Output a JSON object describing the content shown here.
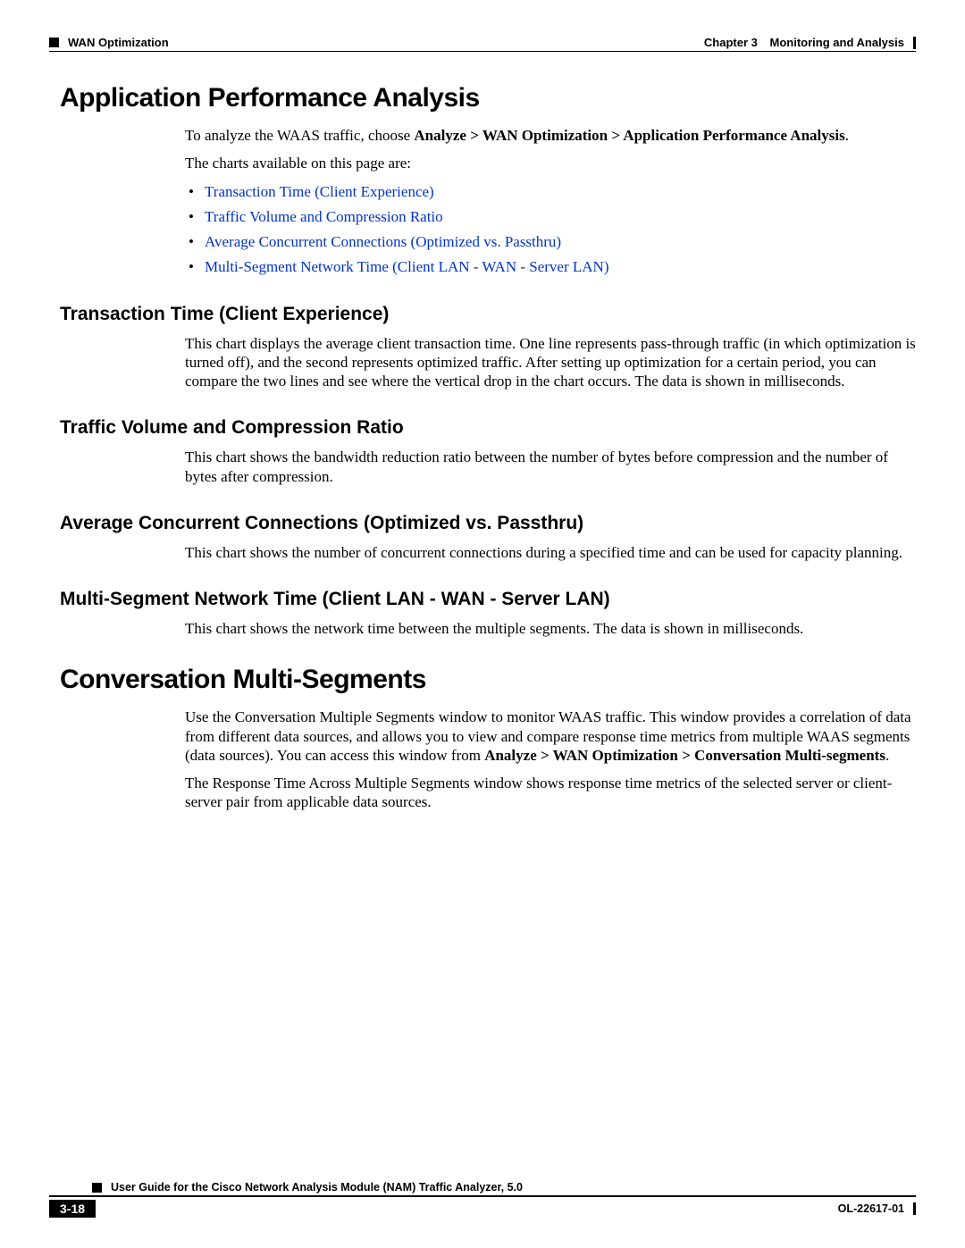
{
  "header": {
    "left_label": "WAN Optimization",
    "chapter_label": "Chapter 3",
    "chapter_title": "Monitoring and Analysis"
  },
  "section1": {
    "title": "Application Performance Analysis",
    "intro_a": "To analyze the WAAS traffic, choose ",
    "intro_b": "Analyze > WAN Optimization > Application Performance Analysis",
    "intro_c": ".",
    "charts_intro": "The charts available on this page are:",
    "bullets": {
      "b1": "Transaction Time (Client Experience)",
      "b2": "Traffic Volume and Compression Ratio",
      "b3": "Average Concurrent Connections (Optimized vs. Passthru)",
      "b4": "Multi-Segment Network Time (Client LAN - WAN - Server LAN)"
    }
  },
  "sub1": {
    "title": "Transaction Time (Client Experience)",
    "body": "This chart displays the average client transaction time. One line represents pass-through traffic (in which optimization is turned off), and the second represents optimized traffic. After setting up optimization for a certain period, you can compare the two lines and see where the vertical drop in the chart occurs. The data is shown in milliseconds."
  },
  "sub2": {
    "title": "Traffic Volume and Compression Ratio",
    "body": "This chart shows the bandwidth reduction ratio between the number of bytes before compression and the number of bytes after compression."
  },
  "sub3": {
    "title": "Average Concurrent Connections (Optimized vs. Passthru)",
    "body": "This chart shows the number of concurrent connections during a specified time and can be used for capacity planning."
  },
  "sub4": {
    "title": "Multi-Segment Network Time (Client LAN - WAN - Server LAN)",
    "body": "This chart shows the network time between the multiple segments. The data is shown in milliseconds."
  },
  "section2": {
    "title": "Conversation Multi-Segments",
    "p1a": "Use the Conversation Multiple Segments window to monitor WAAS traffic. This window provides a correlation of data from different data sources, and allows you to view and compare response time metrics from multiple WAAS segments (data sources). You can access this window from ",
    "p1b": "Analyze > WAN Optimization > Conversation Multi-segments",
    "p1c": ".",
    "p2": "The Response Time Across Multiple Segments window shows response time metrics of the selected server or client-server pair from applicable data sources."
  },
  "footer": {
    "guide_title": "User Guide for the Cisco Network Analysis Module (NAM) Traffic Analyzer, 5.0",
    "page_number": "3-18",
    "doc_id": "OL-22617-01"
  }
}
